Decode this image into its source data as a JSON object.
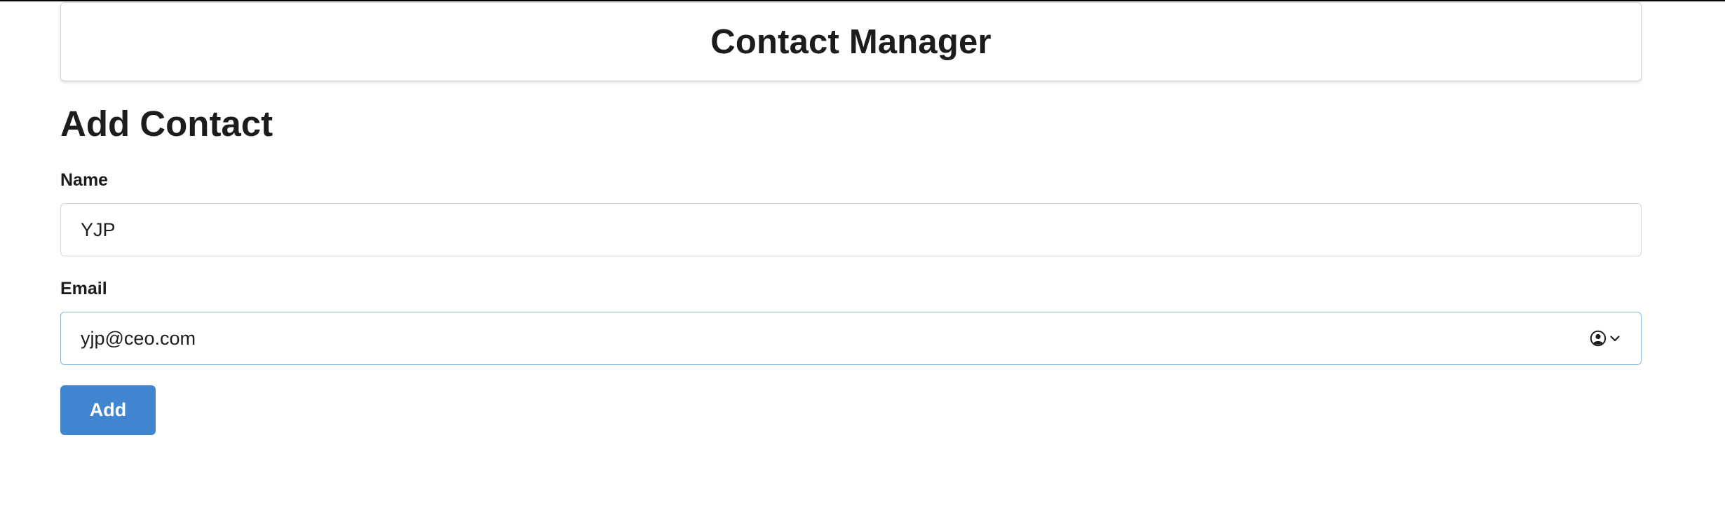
{
  "header": {
    "title": "Contact Manager"
  },
  "form": {
    "title": "Add Contact",
    "name_label": "Name",
    "name_value": "YJP",
    "email_label": "Email",
    "email_value": "yjp@ceo.com",
    "submit_label": "Add"
  },
  "icons": {
    "autofill": "person-circle-icon",
    "autofill_chevron": "chevron-down-icon"
  },
  "colors": {
    "button_bg": "#4185d1",
    "focus_border": "#85b7d9"
  }
}
